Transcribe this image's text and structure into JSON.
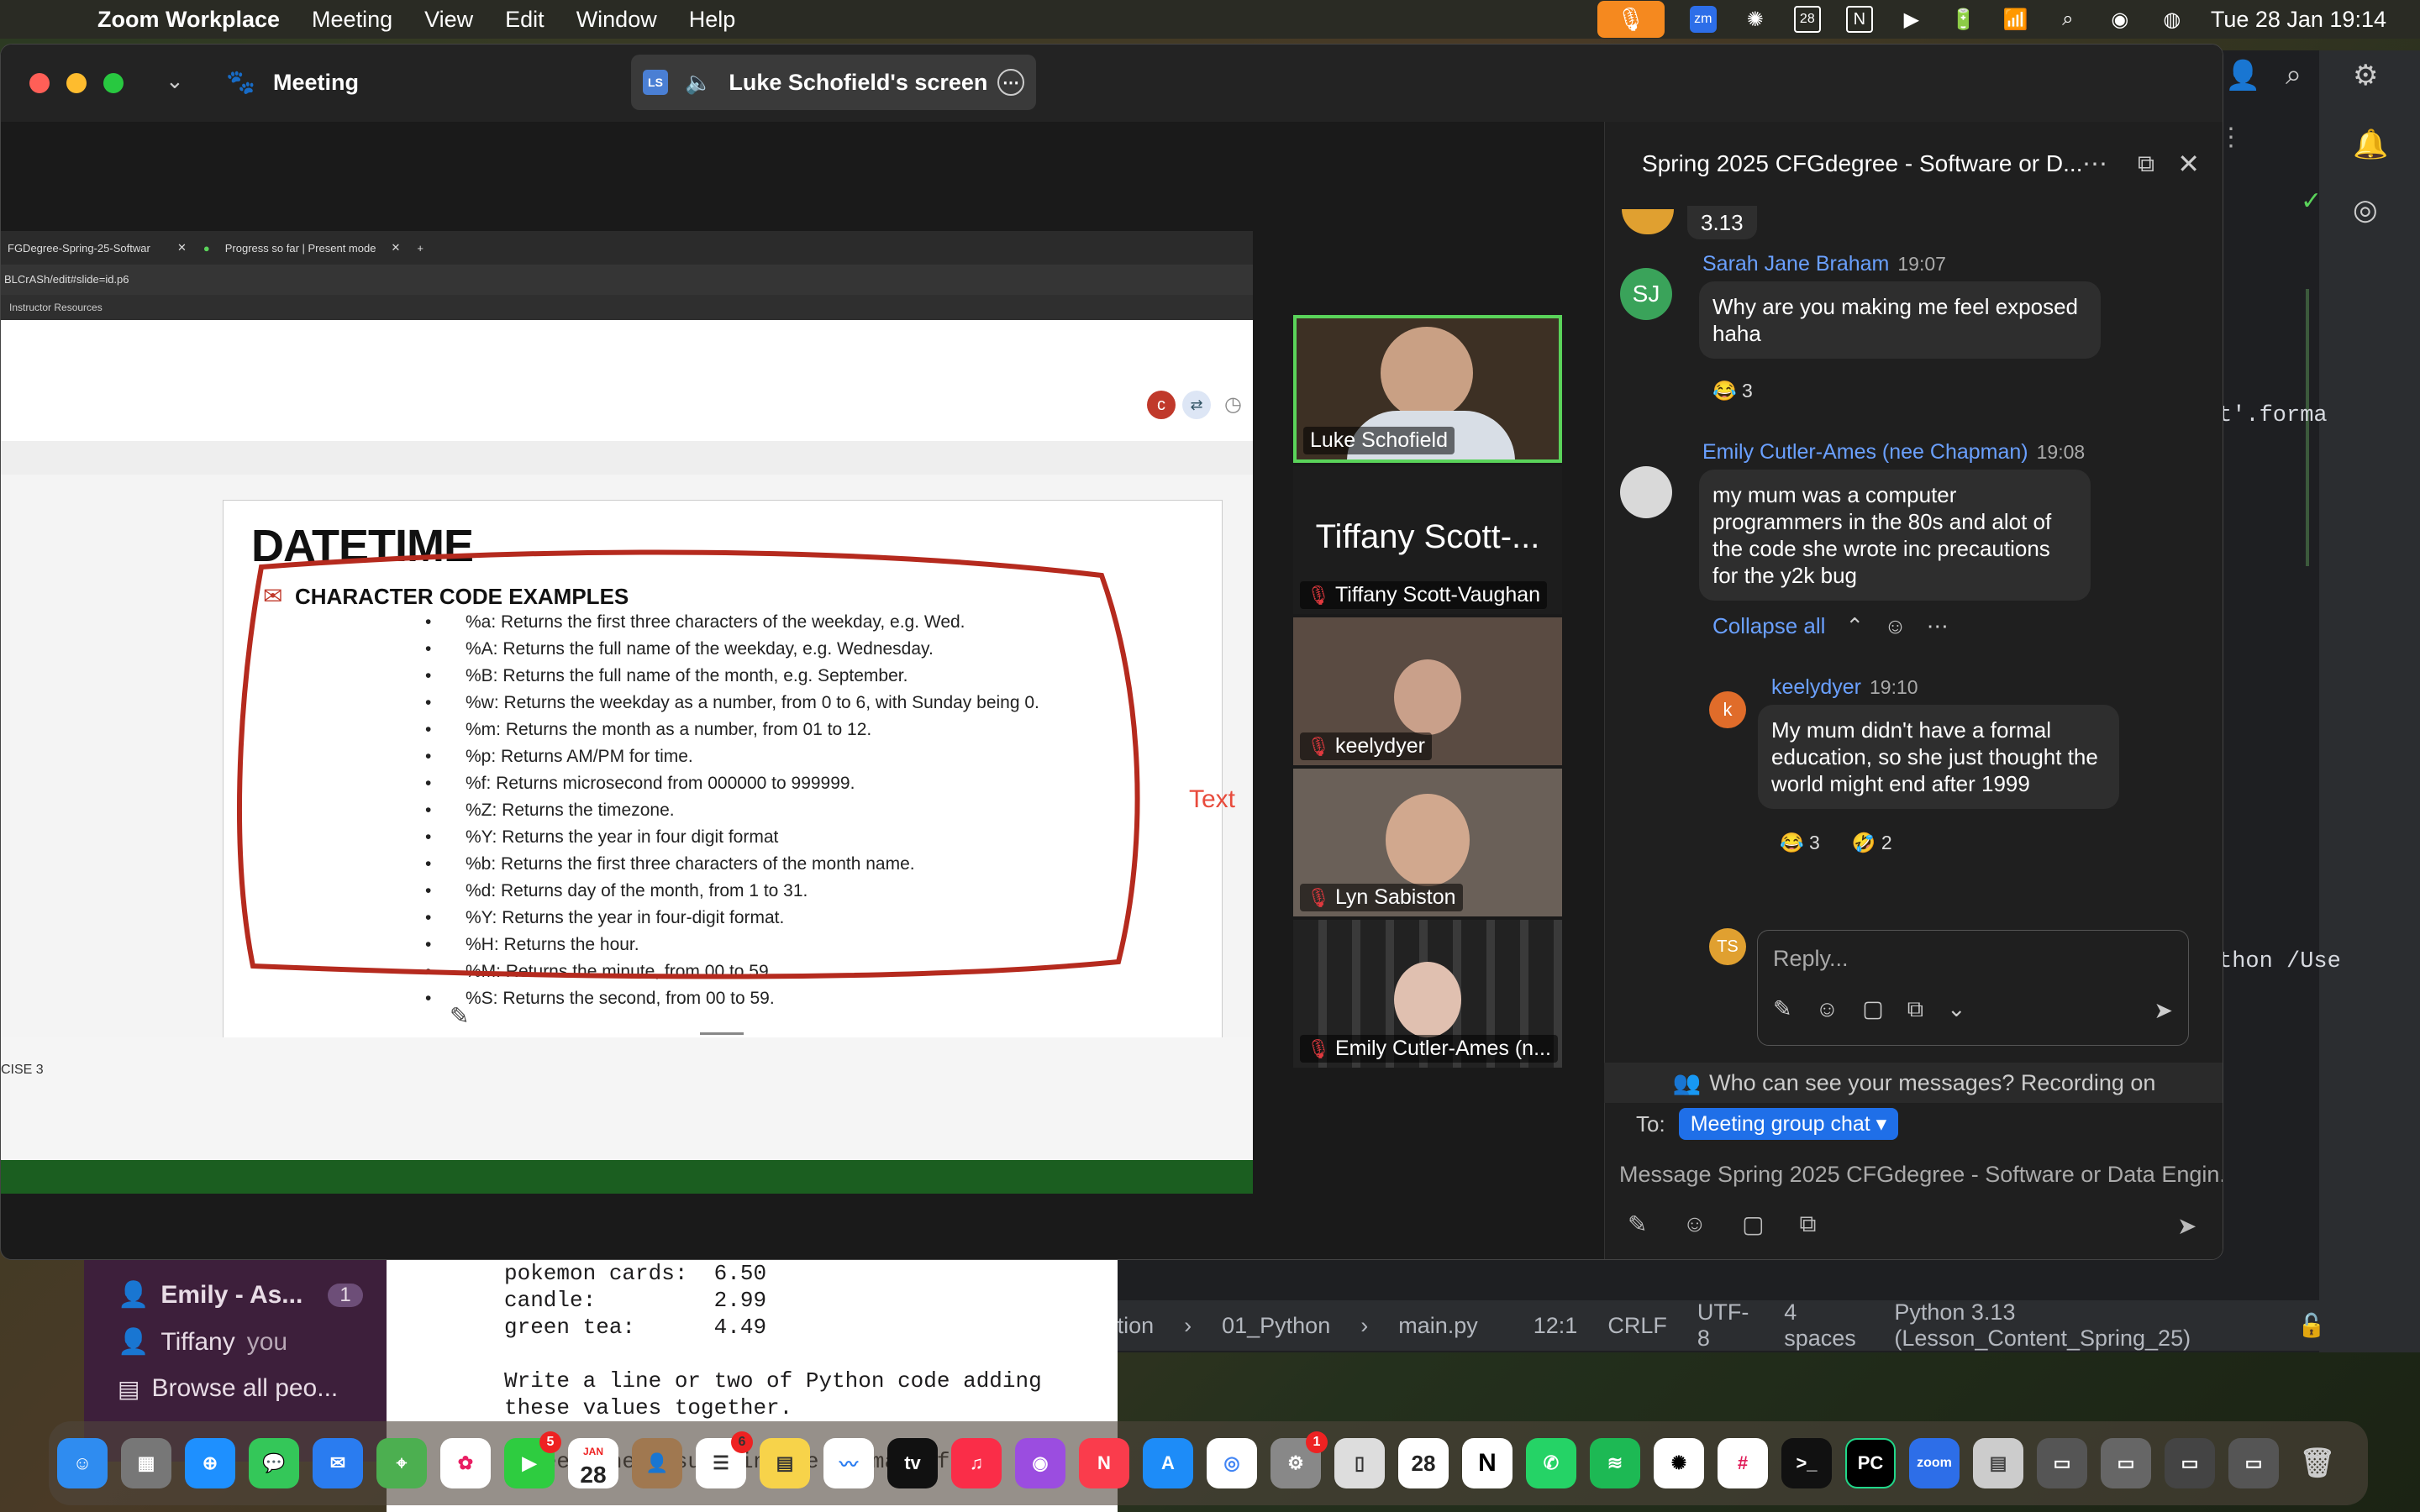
{
  "menubar": {
    "app_name": "Zoom Workplace",
    "items": [
      "Meeting",
      "View",
      "Edit",
      "Window",
      "Help"
    ],
    "clock": "Tue 28 Jan  19:14",
    "calendar_day": "28"
  },
  "zoom": {
    "title": "Meeting",
    "share_initials": "LS",
    "share_label": "Luke Schofield's screen",
    "colors": {
      "accent": "#1f6fe8",
      "active_speaker": "#5ad35a"
    }
  },
  "shared_screen": {
    "tab1": "FGDegree-Spring-25-Softwar",
    "tab2": "Progress so far | Present mode",
    "url": "BLCrASh/edit#slide=id.p6",
    "bookmark": "Instructor Resources",
    "avatar_letter": "c",
    "slide_title": "DATETIME",
    "slide_subtitle": "CHARACTER CODE EXAMPLES",
    "bullets": [
      "%a: Returns the first three characters of the weekday, e.g. Wed.",
      "%A: Returns the full name of the weekday, e.g. Wednesday.",
      "%B: Returns the full name of the month, e.g. September.",
      "%w: Returns the weekday as a number, from 0 to 6, with Sunday being 0.",
      "%m: Returns the month as a number, from 01 to 12.",
      "%p: Returns AM/PM for time.",
      "%f: Returns microsecond from 000000 to 999999.",
      "%Z: Returns the timezone.",
      "%Y: Returns the year in four digit format",
      "%b: Returns the first three characters of the month name.",
      "%d: Returns day of the month, from 1 to 31.",
      "%Y: Returns the year in four-digit format.",
      "%H: Returns the hour.",
      "%M: Returns the minute, from 00 to 59.",
      "%S: Returns the second, from 00 to 59."
    ],
    "side_text": "Text",
    "bottom_label": "CISE 3"
  },
  "gallery": [
    {
      "name": "Luke Schofield",
      "muted": false
    },
    {
      "name": "Tiffany Scott-Vaughan",
      "big_label": "Tiffany Scott-...",
      "muted": true
    },
    {
      "name": "keelydyer",
      "muted": true
    },
    {
      "name": "Lyn Sabiston",
      "muted": true
    },
    {
      "name": "Emily Cutler-Ames (n...",
      "muted": true
    }
  ],
  "chat": {
    "title": "Spring 2025 CFGdegree - Software or D...",
    "partial_top": "3.13",
    "messages": [
      {
        "initials": "SJ",
        "sender": "Sarah Jane Braham",
        "time": "19:07",
        "text": "Why are you making me feel exposed haha",
        "reactions": [
          "😂 3"
        ]
      },
      {
        "sender": "Emily Cutler-Ames (nee Chapman)",
        "time": "19:08",
        "text": "my mum was a computer programmers in the 80s and alot of the code she wrote inc precautions for the y2k bug"
      }
    ],
    "collapse_label": "Collapse all",
    "reply": {
      "initial": "k",
      "sender": "keelydyer",
      "time": "19:10",
      "text": "My mum didn't have a formal education, so she just thought the world might end after 1999",
      "reactions": [
        "😂 3",
        "🤣 2"
      ]
    },
    "reply_initials": "TS",
    "reply_placeholder": "Reply...",
    "notice": "Who can see your messages? Recording on",
    "to_label": "To:",
    "to_value": "Meeting group chat",
    "compose_placeholder": "Message Spring 2025 CFGdegree - Software or Data Engin..."
  },
  "pycharm": {
    "code_line1": "t'.forma",
    "code_line2": "thon /Use",
    "status": [
      "Foundation",
      "01_Python",
      "main.py",
      "12:1",
      "CRLF",
      "UTF-8",
      "4 spaces",
      "Python 3.13 (Lesson_Content_Spring_25)"
    ]
  },
  "slack": {
    "rows": [
      {
        "label": "Emily - As...",
        "badge": "1"
      },
      {
        "label": "Tiffany",
        "suffix": "you"
      },
      {
        "label": "Browse all peo..."
      }
    ],
    "text": "pokemon cards:  6.50\ncandle:         2.99\ngreen tea:      4.49\n\nWrite a line or two of Python code adding\nthese values together.\n\nI need the result in the format of:"
  },
  "dock": {
    "badges": {
      "facetime": "5",
      "reminders": "6",
      "settings": "1"
    },
    "calendar_day": "28",
    "calendar_month": "JAN",
    "zoom_label": "zoom",
    "tv_label": "tv",
    "notion_label": "N",
    "pycharm_label": "PC"
  }
}
